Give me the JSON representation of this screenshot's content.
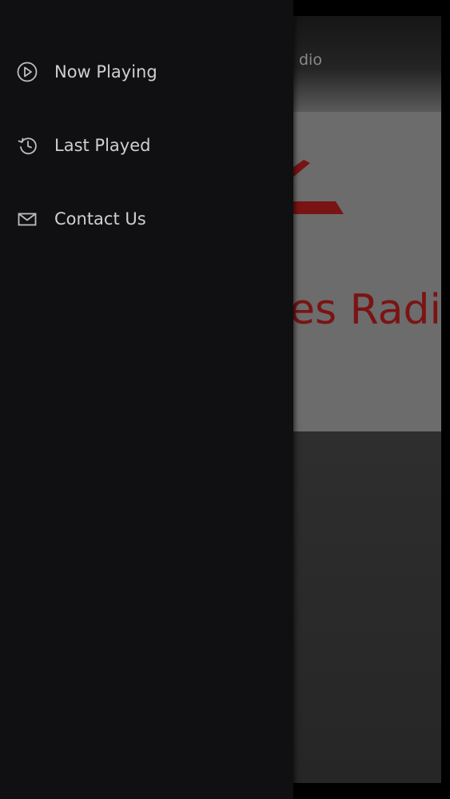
{
  "background_app": {
    "header_title_partial": "dio",
    "brand_text_partial": "es Radio",
    "brand_color": "#7a1414"
  },
  "drawer": {
    "items": [
      {
        "label": "Now Playing",
        "icon": "play-circle-icon"
      },
      {
        "label": "Last Played",
        "icon": "history-icon"
      },
      {
        "label": "Contact Us",
        "icon": "envelope-icon"
      }
    ]
  },
  "colors": {
    "drawer_bg": "#101012",
    "nav_text": "#cfcfcf",
    "icon_stroke": "#bdbdbd"
  }
}
